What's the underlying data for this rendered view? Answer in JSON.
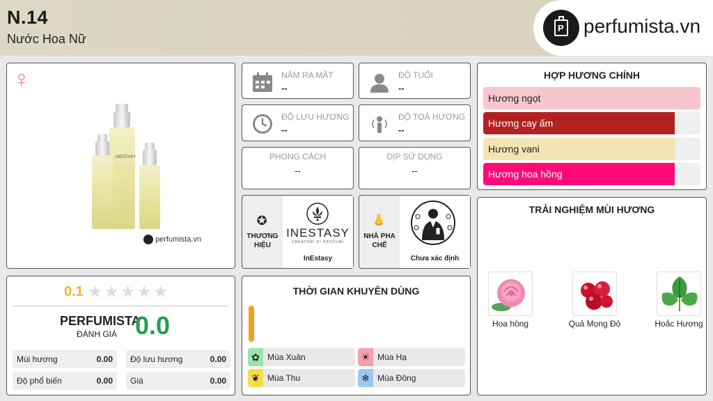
{
  "header": {
    "title": "N.14",
    "subtitle": "Nước Hoa Nữ",
    "logo_text": "perfumista.vn"
  },
  "product": {
    "gender_icon": "female-symbol-icon",
    "image_caption": "perfumista.vn",
    "bottle_brand": "INESTASY"
  },
  "info": {
    "release_label": "NĂM RA MẮT",
    "release_value": "--",
    "age_label": "ĐỘ TUỔI",
    "age_value": "--",
    "longevity_label": "ĐỘ LƯU HƯƠNG",
    "longevity_value": "--",
    "sillage_label": "ĐỘ TOẢ HƯƠNG",
    "sillage_value": "--",
    "style_label": "PHONG CÁCH",
    "style_value": "--",
    "occasion_label": "DỊP SỬ DỤNG",
    "occasion_value": "--"
  },
  "brand": {
    "label": "THƯƠNG HIỆU",
    "logo_text": "INESTASY",
    "logo_sub": "CREATORI DI PROFUMI",
    "name": "InEstasy"
  },
  "perfumer": {
    "label": "NHÀ PHA CHẾ",
    "name": "Chưa xác định"
  },
  "accords": {
    "title": "HỢP HƯƠNG CHÍNH",
    "items": [
      {
        "label": "Hương ngọt",
        "fill": 1.0,
        "color": "#f8c6cf",
        "text_color": "#222222"
      },
      {
        "label": "Hương cay ấm",
        "fill": 0.88,
        "color": "#b22222",
        "text_color": "#ffffff"
      },
      {
        "label": "Hương vani",
        "fill": 0.88,
        "color": "#f3e5b3",
        "text_color": "#222222"
      },
      {
        "label": "Hương hoa hồng",
        "fill": 0.88,
        "color": "#ff0a78",
        "text_color": "#ffffff"
      }
    ]
  },
  "experience": {
    "title": "TRẢI NGHIỆM MÙI HƯƠNG",
    "items": [
      {
        "label": "Hoa hồng",
        "icon": "rose-icon"
      },
      {
        "label": "Quả Mọng Đỏ",
        "icon": "red-berries-icon"
      },
      {
        "label": "Hoắc Hương",
        "icon": "patchouli-leaf-icon"
      }
    ]
  },
  "ratings": {
    "user_score": "0.1",
    "stars_filled": 0,
    "stars_total": 5,
    "pf_name": "PERFUMISTA",
    "pf_sub": "ĐÁNH GIÁ",
    "pf_score": "0.0",
    "metrics": [
      {
        "label": "Mùi hương",
        "value": "0.00"
      },
      {
        "label": "Độ lưu hương",
        "value": "0.00"
      },
      {
        "label": "Độ phổ biến",
        "value": "0.00"
      },
      {
        "label": "Giá",
        "value": "0.00"
      }
    ]
  },
  "usage": {
    "title": "THỜI GIAN KHUYÊN DÙNG",
    "seasons": [
      {
        "label": "Mùa Xuân",
        "color": "#9be3a8"
      },
      {
        "label": "Mùa Hạ",
        "color": "#f5a0a8"
      },
      {
        "label": "Mùa Thu",
        "color": "#f5dd4a"
      },
      {
        "label": "Mùa Đông",
        "color": "#9cc8f0"
      }
    ],
    "accent_color": "#f0a020"
  }
}
